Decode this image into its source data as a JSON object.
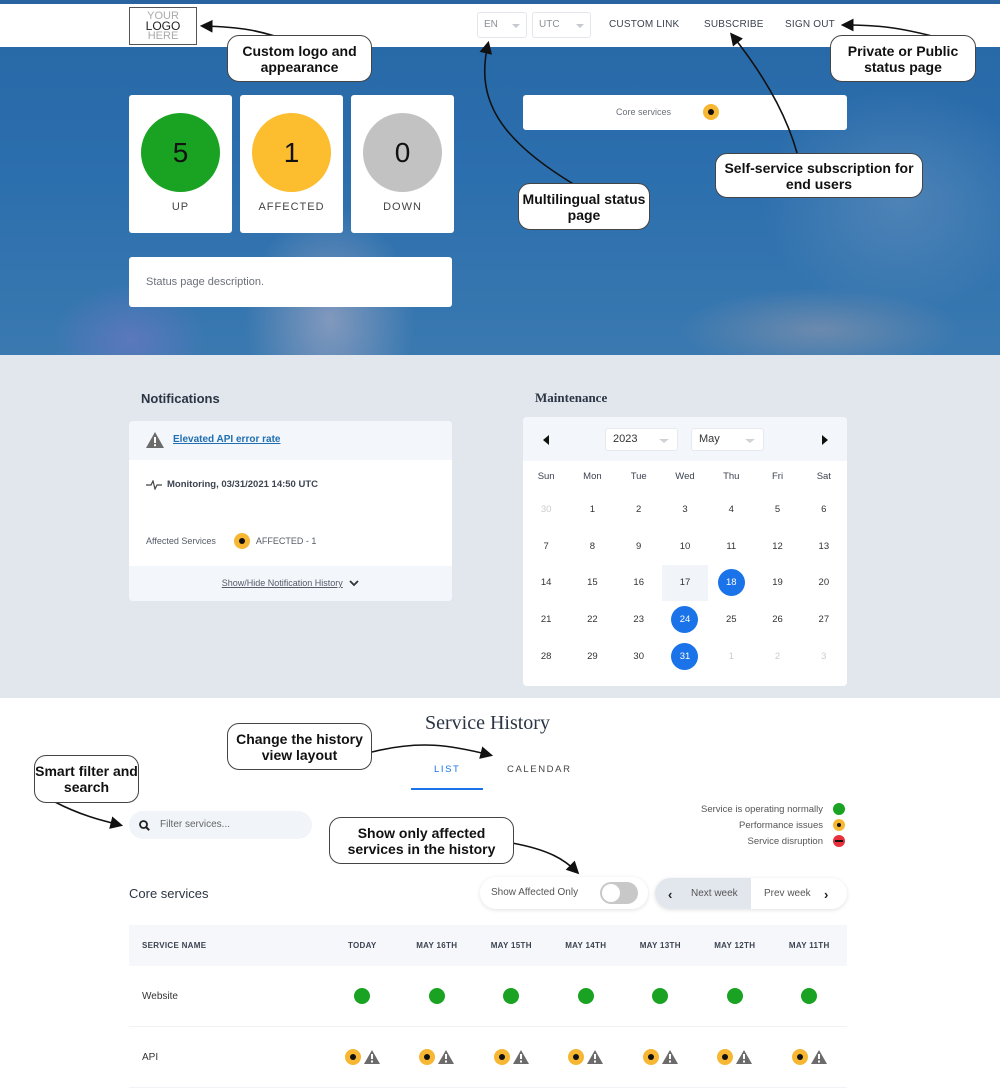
{
  "header": {
    "logo": {
      "line1": "YOUR",
      "line2": "LOGO",
      "line3": "HERE"
    },
    "language_select": "EN",
    "timezone_select": "UTC",
    "links": [
      "CUSTOM LINK",
      "SUBSCRIBE",
      "SIGN OUT"
    ]
  },
  "summary": {
    "stats": [
      {
        "count": "5",
        "label": "UP",
        "color": "#1aa323"
      },
      {
        "count": "1",
        "label": "AFFECTED",
        "color": "#fcbd2e"
      },
      {
        "count": "0",
        "label": "DOWN",
        "color": "#c2c2c2"
      }
    ],
    "description": "Status page description.",
    "group": {
      "name": "Core services",
      "status": "affected"
    }
  },
  "notifications": {
    "title": "Notifications",
    "items": [
      {
        "title": "Elevated API error rate",
        "status_line": "Monitoring, 03/31/2021 14:50 UTC",
        "affected_label": "Affected Services",
        "affected_value": "AFFECTED - 1"
      }
    ],
    "history_toggle": "Show/Hide Notification History"
  },
  "maintenance": {
    "title": "Maintenance",
    "year": "2023",
    "month": "May",
    "weekdays": [
      "Sun",
      "Mon",
      "Tue",
      "Wed",
      "Thu",
      "Fri",
      "Sat"
    ],
    "weeks": [
      [
        "30",
        "1",
        "2",
        "3",
        "4",
        "5",
        "6"
      ],
      [
        "7",
        "8",
        "9",
        "10",
        "11",
        "12",
        "13"
      ],
      [
        "14",
        "15",
        "16",
        "17",
        "18",
        "19",
        "20"
      ],
      [
        "21",
        "22",
        "23",
        "24",
        "25",
        "26",
        "27"
      ],
      [
        "28",
        "29",
        "30",
        "31",
        "1",
        "2",
        "3"
      ]
    ],
    "today": "17",
    "scheduled_days": [
      "18",
      "24",
      "31"
    ]
  },
  "service_history": {
    "title": "Service History",
    "tabs": [
      {
        "label": "LIST",
        "active": true
      },
      {
        "label": "CALENDAR",
        "active": false
      }
    ],
    "search_placeholder": "Filter services...",
    "legend": [
      {
        "label": "Service is operating normally",
        "status": "operational"
      },
      {
        "label": "Performance issues",
        "status": "performance"
      },
      {
        "label": "Service disruption",
        "status": "disruption"
      }
    ],
    "group_title": "Core services",
    "show_affected_label": "Show Affected Only",
    "show_affected_on": false,
    "next_week": "Next week",
    "prev_week": "Prev week",
    "columns": [
      "SERVICE NAME",
      "TODAY",
      "MAY 16TH",
      "MAY 15TH",
      "MAY 14TH",
      "MAY 13TH",
      "MAY 12TH",
      "MAY 11TH"
    ],
    "rows": [
      {
        "name": "Website",
        "days": [
          "operational",
          "operational",
          "operational",
          "operational",
          "operational",
          "operational",
          "operational"
        ]
      },
      {
        "name": "API",
        "days": [
          "performance",
          "performance",
          "performance",
          "performance",
          "performance",
          "performance",
          "performance"
        ]
      }
    ]
  },
  "callouts": {
    "logo": "Custom logo and appearance",
    "multilingual": "Multilingual status page",
    "subscription": "Self-service subscription for end users",
    "private": "Private or Public status page",
    "layout": "Change the history view layout",
    "filter": "Smart filter and search",
    "affected": "Show only affected services in the history"
  }
}
